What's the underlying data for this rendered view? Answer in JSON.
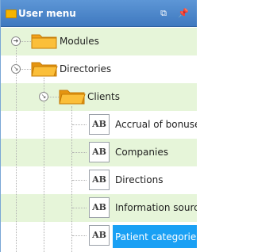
{
  "panel": {
    "title": "User menu",
    "buttons": {
      "restore_icon": "restore-window-icon",
      "pin_icon": "pin-icon"
    }
  },
  "tree": {
    "items": [
      {
        "label": "Modules"
      },
      {
        "label": "Directories"
      },
      {
        "label": "Clients"
      },
      {
        "label": "Accrual of bonuses",
        "icon_text": "AB"
      },
      {
        "label": "Companies",
        "icon_text": "AB"
      },
      {
        "label": "Directions",
        "icon_text": "AB"
      },
      {
        "label": "Information sources",
        "icon_text": "AB"
      },
      {
        "label": "Patient categories",
        "icon_text": "AB",
        "selected": true
      }
    ]
  },
  "colors": {
    "titlebar": "#4a87cf",
    "selection": "#1aa0f4",
    "row_tint": "#e6f5d9"
  }
}
